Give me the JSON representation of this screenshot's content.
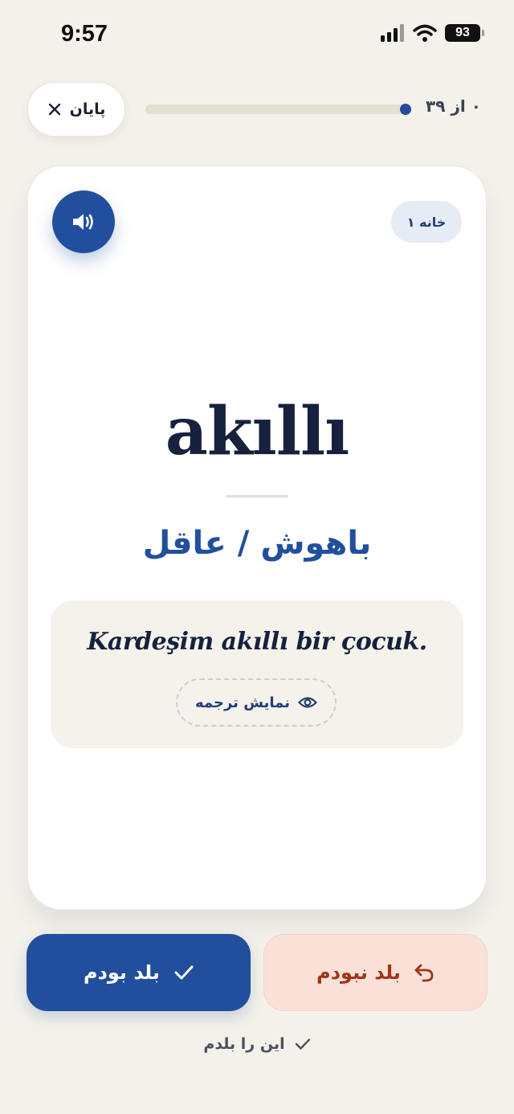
{
  "status_bar": {
    "time": "9:57",
    "battery": "93"
  },
  "top_bar": {
    "finish_label": "پایان",
    "progress_text": "۰ از ۳۹",
    "progress_fraction": 0.97
  },
  "card": {
    "box_label": "خانه ۱",
    "word": "akıllı",
    "meaning": "باهوش / عاقل",
    "example_sentence": "Kardeşim akıllı bir çocuk.",
    "show_translation_label": "نمایش ترجمه"
  },
  "actions": {
    "knew_label": "بلد بودم",
    "didnt_know_label": "بلد نبودم",
    "know_this_label": "این را بلدم"
  },
  "colors": {
    "background": "#f3f1ea",
    "primary": "#214f9e",
    "negative_bg": "#f9e1d8",
    "negative_text": "#a0341a"
  },
  "icons": {
    "audio": "speaker-icon",
    "close": "close-icon",
    "eye": "eye-icon",
    "check": "check-icon",
    "undo": "undo-icon"
  }
}
